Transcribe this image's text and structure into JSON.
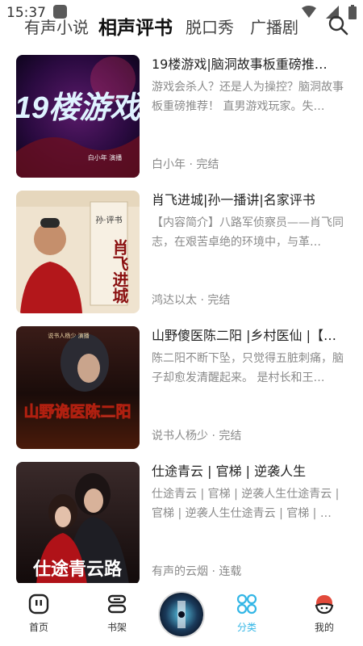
{
  "status": {
    "time": "15:37"
  },
  "tabs": [
    {
      "label": "有声小说"
    },
    {
      "label": "相声评书"
    },
    {
      "label": "脱口秀"
    },
    {
      "label": "广播剧"
    }
  ],
  "list": [
    {
      "title": "19楼游戏|脑洞故事板重磅推…",
      "desc": "游戏会杀人？还是人为操控？脑洞故事板重磅推荐！ 直男游戏玩家。失…",
      "meta": "白小年 · 完结",
      "cover_text": "19楼游戏",
      "cover_sub": "白小年 演播"
    },
    {
      "title": "肖飞进城|孙一播讲|名家评书",
      "desc": "【内容简介】八路军侦察员——肖飞同志，在艰苦卓绝的环境中，与革…",
      "meta": "鸿达以太 · 完结",
      "cover_text": "肖飞进城",
      "cover_sub": "孙·评书"
    },
    {
      "title": "山野傻医陈二阳 |乡村医仙 |【…",
      "desc": "陈二阳不断下坠，只觉得五脏刺痛，脑子却愈发清醒起来。 是村长和王…",
      "meta": "说书人杨少 · 完结",
      "cover_text": "山野诡医陈二阳",
      "cover_sub": "说书人杨少 演播"
    },
    {
      "title": "仕途青云 | 官梯 | 逆袭人生",
      "desc": "仕途青云 | 官梯 | 逆袭人生仕途青云 | 官梯 | 逆袭人生仕途青云 | 官梯 | …",
      "meta": "有声的云烟 · 连载",
      "cover_text": "仕途青云路",
      "cover_sub": ""
    }
  ],
  "nav": {
    "home": "首页",
    "shelf": "书架",
    "category": "分类",
    "mine": "我的"
  },
  "colors": {
    "accent": "#33b6e6",
    "text_muted": "#8a8a8a"
  }
}
